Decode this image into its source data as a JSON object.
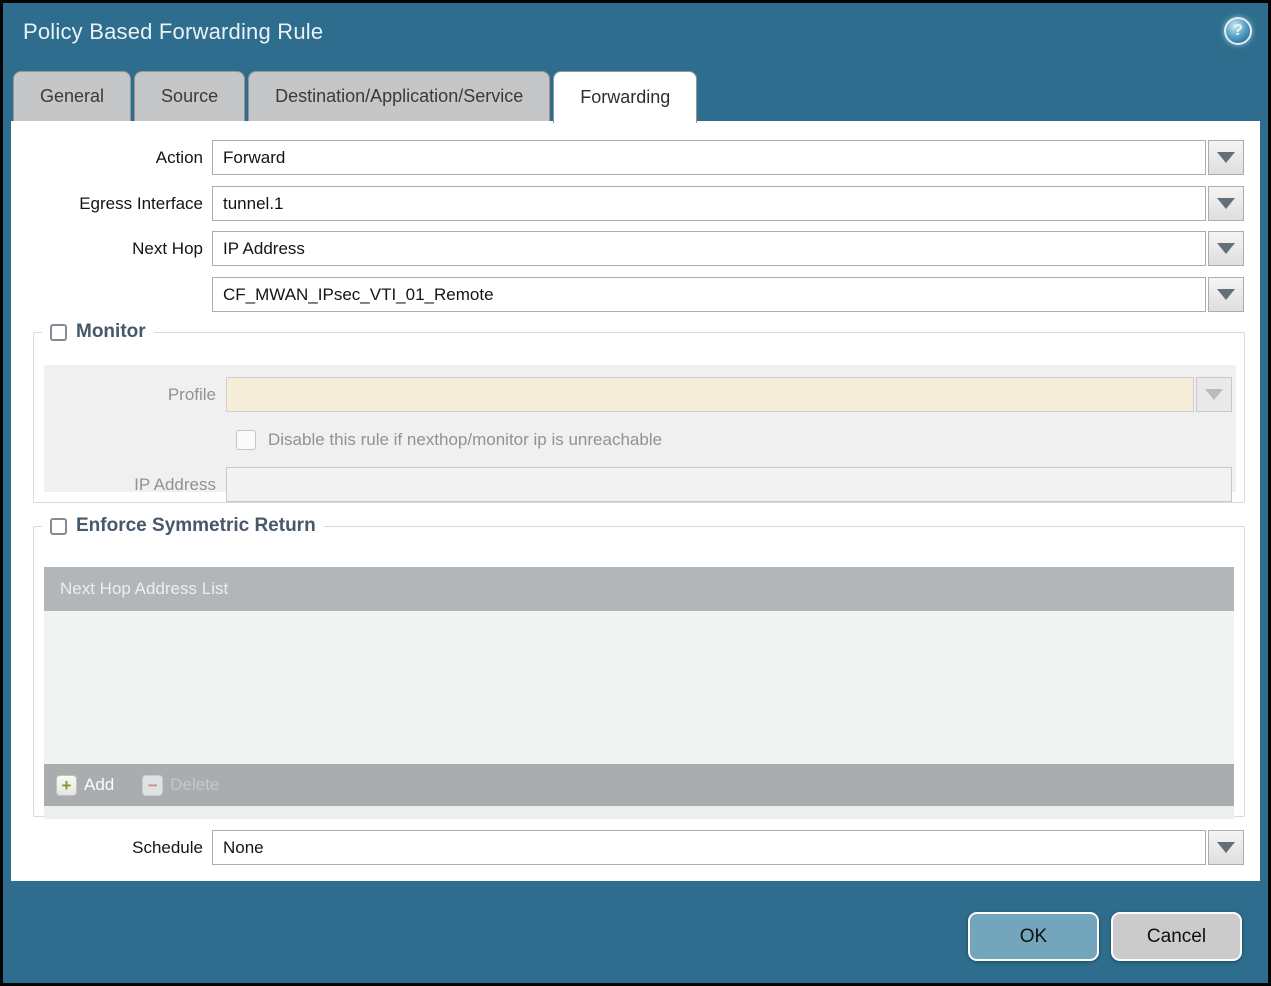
{
  "window": {
    "title": "Policy Based Forwarding Rule"
  },
  "icons": {
    "help_glyph": "?",
    "add_glyph": "+",
    "delete_glyph": "−"
  },
  "tabs": [
    {
      "label": "General",
      "active": false
    },
    {
      "label": "Source",
      "active": false
    },
    {
      "label": "Destination/Application/Service",
      "active": false
    },
    {
      "label": "Forwarding",
      "active": true
    }
  ],
  "form": {
    "action": {
      "label": "Action",
      "value": "Forward"
    },
    "egress_interface": {
      "label": "Egress Interface",
      "value": "tunnel.1"
    },
    "next_hop": {
      "label": "Next Hop",
      "value": "IP Address"
    },
    "next_hop_address": {
      "value": "CF_MWAN_IPsec_VTI_01_Remote"
    },
    "schedule": {
      "label": "Schedule",
      "value": "None"
    }
  },
  "monitor": {
    "legend": "Monitor",
    "checked": false,
    "profile": {
      "label": "Profile",
      "value": ""
    },
    "disable_rule": {
      "label": "Disable this rule if nexthop/monitor ip is unreachable",
      "checked": false
    },
    "ip_address": {
      "label": "IP Address",
      "value": ""
    }
  },
  "enforce_symmetric_return": {
    "legend": "Enforce Symmetric Return",
    "checked": false,
    "table": {
      "header": "Next Hop Address List",
      "rows": []
    },
    "toolbar": {
      "add_label": "Add",
      "delete_label": "Delete"
    }
  },
  "footer": {
    "ok_label": "OK",
    "cancel_label": "Cancel"
  },
  "colors": {
    "titlebar_teal": "#2E6D8D",
    "ok_button": "#73A6BC",
    "disabled_field_beige": "#F5EDD8",
    "table_header_gray": "#B3B6B9",
    "table_footer_gray": "#A9ADB0",
    "legend_text": "#46586A",
    "add_icon_green": "#7C9D2E",
    "delete_icon_pink": "#C98D93"
  }
}
